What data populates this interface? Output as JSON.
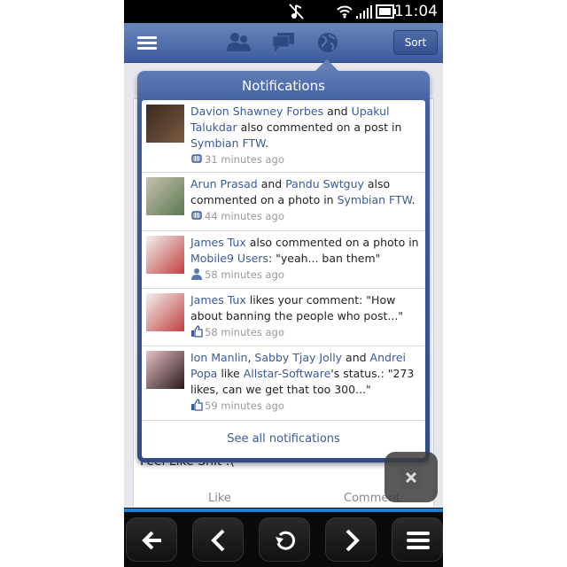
{
  "status_bar": {
    "time": "11:04",
    "icons": [
      "silent-icon",
      "wifi-icon",
      "signal-icon",
      "battery-icon"
    ]
  },
  "header": {
    "icons": [
      "menu-icon",
      "friends-icon",
      "messages-icon",
      "notifications-globe-icon"
    ],
    "sort_label": "Sort"
  },
  "background": {
    "post_text": "Feel Like Shit :(",
    "like_label": "Like",
    "comment_label": "Comment"
  },
  "notifications": {
    "title": "Notifications",
    "items": [
      {
        "segments": [
          {
            "t": "Davion Shawney Forbes",
            "link": true
          },
          {
            "t": " and ",
            "link": false
          },
          {
            "t": "Upakul Talukdar",
            "link": true
          },
          {
            "t": " also commented on a post in ",
            "link": false
          },
          {
            "t": "Symbian FTW",
            "link": true
          },
          {
            "t": ".",
            "link": false
          }
        ],
        "time": "31 minutes ago",
        "icon": "group-icon"
      },
      {
        "segments": [
          {
            "t": "Arun Prasad",
            "link": true
          },
          {
            "t": " and ",
            "link": false
          },
          {
            "t": "Pandu Swtguy",
            "link": true
          },
          {
            "t": " also commented on a photo in ",
            "link": false
          },
          {
            "t": "Symbian FTW",
            "link": true
          },
          {
            "t": ".",
            "link": false
          }
        ],
        "time": "44 minutes ago",
        "icon": "group-icon"
      },
      {
        "segments": [
          {
            "t": "James Tux",
            "link": true
          },
          {
            "t": " also commented on a photo in ",
            "link": false
          },
          {
            "t": "Mobile9 Users",
            "link": true
          },
          {
            "t": ": \"yeah... ban them\"",
            "link": false
          }
        ],
        "time": "58 minutes ago",
        "icon": "user-icon"
      },
      {
        "segments": [
          {
            "t": "James Tux",
            "link": true
          },
          {
            "t": " likes your comment: \"How about banning the people who post...\"",
            "link": false
          }
        ],
        "time": "58 minutes ago",
        "icon": "thumbs-up-icon"
      },
      {
        "segments": [
          {
            "t": "Ion Manlin",
            "link": true
          },
          {
            "t": ", ",
            "link": false
          },
          {
            "t": "Sabby Tjay Jolly",
            "link": true
          },
          {
            "t": " and ",
            "link": false
          },
          {
            "t": "Andrei Popa",
            "link": true
          },
          {
            "t": " like ",
            "link": false
          },
          {
            "t": "Allstar-Software",
            "link": true
          },
          {
            "t": "'s status.: \"273 likes, can we get that too 300...\"",
            "link": false
          }
        ],
        "time": "59 minutes ago",
        "icon": "thumbs-up-icon"
      }
    ],
    "see_all": "See all notifications"
  },
  "colors": {
    "header_blue": "#3d5c9c",
    "link": "#3b5998",
    "progress": "#1f7fd8"
  }
}
